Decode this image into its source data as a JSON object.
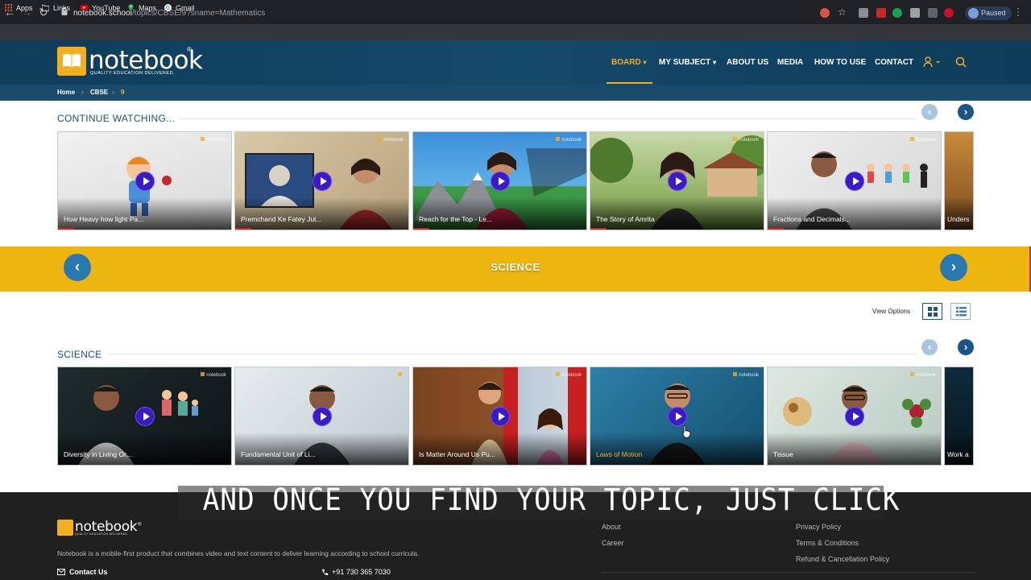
{
  "browser": {
    "url_host": "notebook.school",
    "url_path": "/topics/CBSE/9?sname=Mathematics",
    "profile_status": "Paused",
    "bookmarks": [
      {
        "label": "Apps",
        "icon": "grid-icon"
      },
      {
        "label": "Links",
        "icon": "folder-icon"
      },
      {
        "label": "YouTube",
        "icon": "youtube-icon"
      },
      {
        "label": "Maps",
        "icon": "maps-pin-icon"
      },
      {
        "label": "Gmail",
        "icon": "google-g-icon"
      }
    ]
  },
  "site": {
    "logo_text": "notebook",
    "logo_reg": "®",
    "logo_tagline": "QUALITY EDUCATION DELIVERED.",
    "nav": [
      {
        "label": "BOARD",
        "active": true,
        "dropdown": true
      },
      {
        "label": "MY SUBJECT",
        "dropdown": true
      },
      {
        "label": "ABOUT US"
      },
      {
        "label": "MEDIA"
      },
      {
        "label": "HOW TO USE"
      },
      {
        "label": "CONTACT"
      }
    ],
    "nav_caret": "▾",
    "accent_color": "#f2b01e",
    "header_color": "#14486a"
  },
  "breadcrumb": {
    "items": [
      "Home",
      "CBSE",
      "9"
    ],
    "separator": "›"
  },
  "continue_watching": {
    "title": "CONTINUE WATCHING...",
    "cards": [
      {
        "title": "How Heavy how light Pa..."
      },
      {
        "title": "Premchand Ke Fatey Jut..."
      },
      {
        "title": "Reach for the Top - Le..."
      },
      {
        "title": "The Story of Amrita"
      },
      {
        "title": "Fractions and Decimals..."
      },
      {
        "title": "Unders"
      }
    ]
  },
  "subject_band": {
    "label": "SCIENCE",
    "prev": "‹",
    "next": "›",
    "color": "#ecb50f"
  },
  "view_options": {
    "label": "View Options",
    "selected": "grid"
  },
  "science_row": {
    "title": "SCIENCE",
    "cards": [
      {
        "title": "Diversity in Living Or..."
      },
      {
        "title": "Fundamental Unit of Li..."
      },
      {
        "title": "Is Matter Around Us Pu..."
      },
      {
        "title": "Laws of Motion",
        "hovered": true
      },
      {
        "title": "Tissue"
      },
      {
        "title": "Work a"
      }
    ]
  },
  "row_nav": {
    "prev": "‹",
    "next": "›"
  },
  "footer": {
    "logo_text": "notebook",
    "logo_reg": "®",
    "logo_tagline": "QUALITY EDUCATION DELIVERED.",
    "description": "Notebook is a mobile-first product that combines video and text content to deliver learning according to school curricula.",
    "contact_label": "Contact Us",
    "phone": "+91 730 365 7030",
    "links_col1": [
      "About",
      "Career"
    ],
    "links_col2": [
      "Privacy Policy",
      "Terms & Conditions",
      "Refund & Cancellation Policy"
    ]
  },
  "caption": "AND ONCE YOU FIND YOUR TOPIC, JUST CLICK"
}
